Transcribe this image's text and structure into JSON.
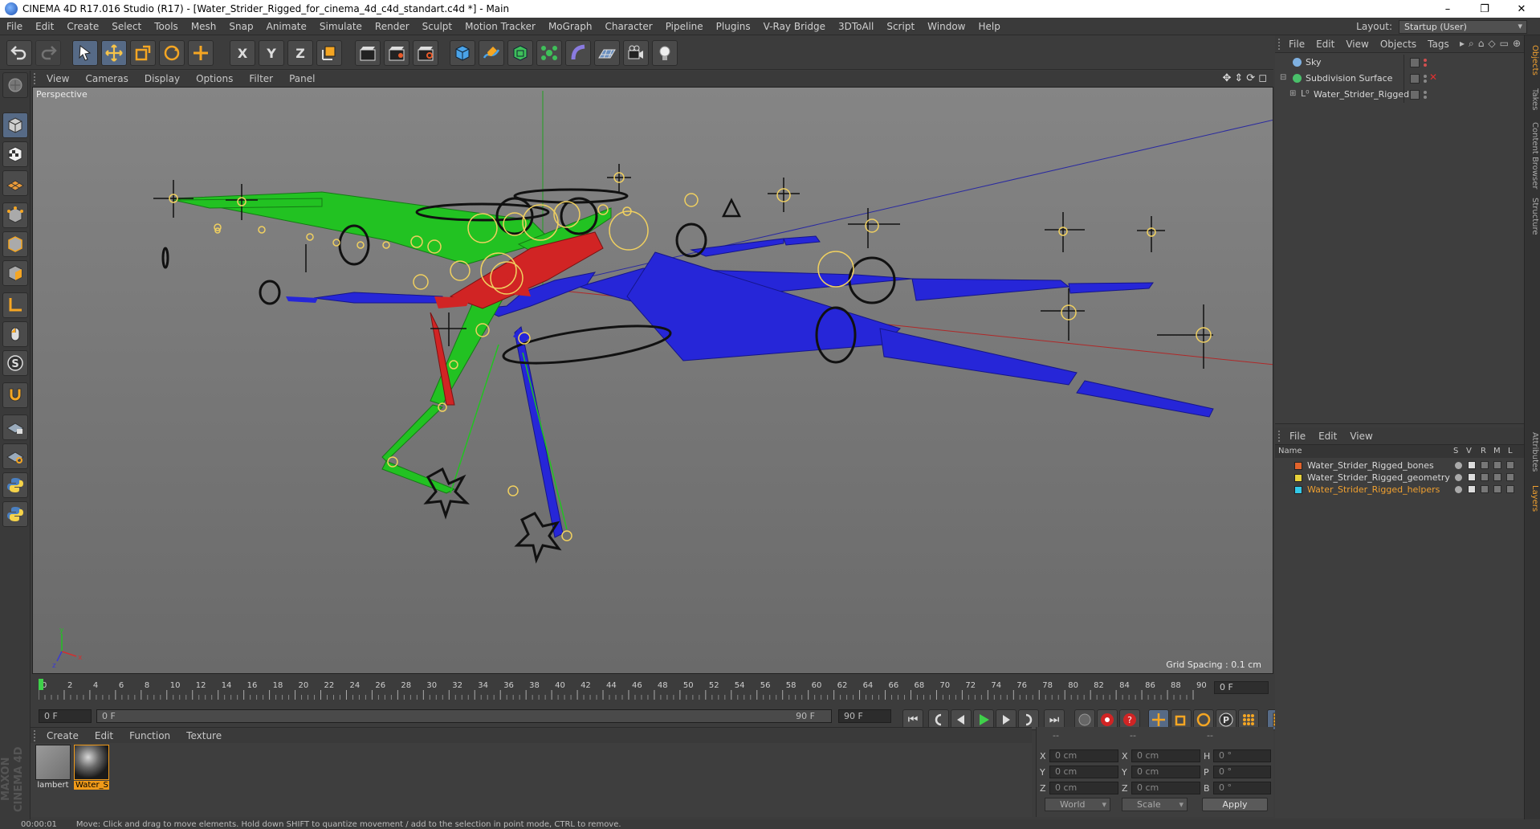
{
  "window": {
    "title": "CINEMA 4D R17.016 Studio (R17) - [Water_Strider_Rigged_for_cinema_4d_c4d_standart.c4d *] - Main",
    "minimize": "–",
    "maximize": "❐",
    "close": "✕"
  },
  "menubar": {
    "items": [
      "File",
      "Edit",
      "Create",
      "Select",
      "Tools",
      "Mesh",
      "Snap",
      "Animate",
      "Simulate",
      "Render",
      "Sculpt",
      "Motion Tracker",
      "MoGraph",
      "Character",
      "Pipeline",
      "Plugins",
      "V-Ray Bridge",
      "3DToAll",
      "Script",
      "Window",
      "Help"
    ],
    "layout_label": "Layout:",
    "layout_value": "Startup (User)"
  },
  "toolbar": {
    "x_label": "X",
    "y_label": "Y",
    "z_label": "Z"
  },
  "viewport": {
    "menu": [
      "View",
      "Cameras",
      "Display",
      "Options",
      "Filter",
      "Panel"
    ],
    "camera_label": "Perspective",
    "grid_spacing": "Grid Spacing : 0.1 cm"
  },
  "timeline": {
    "ticks": [
      "0",
      "2",
      "4",
      "6",
      "8",
      "10",
      "12",
      "14",
      "16",
      "18",
      "20",
      "22",
      "24",
      "26",
      "28",
      "30",
      "32",
      "34",
      "36",
      "38",
      "40",
      "42",
      "44",
      "46",
      "48",
      "50",
      "52",
      "54",
      "56",
      "58",
      "60",
      "62",
      "64",
      "66",
      "68",
      "70",
      "72",
      "74",
      "76",
      "78",
      "80",
      "82",
      "84",
      "86",
      "88",
      "90"
    ],
    "current_frame": "0 F"
  },
  "transport": {
    "start_frame": "0 F",
    "range_start": "0 F",
    "range_end": "90 F",
    "end_frame": "90 F"
  },
  "material_manager": {
    "menu": [
      "Create",
      "Edit",
      "Function",
      "Texture"
    ],
    "materials": [
      {
        "name": "lambert",
        "selected": false
      },
      {
        "name": "Water_S",
        "selected": true
      }
    ]
  },
  "coordinates": {
    "header_pos": "--",
    "header_size": "--",
    "header_rot": "--",
    "rows": [
      {
        "pos_label": "X",
        "pos_value": "0 cm",
        "size_label": "X",
        "size_value": "0 cm",
        "rot_label": "H",
        "rot_value": "0 °"
      },
      {
        "pos_label": "Y",
        "pos_value": "0 cm",
        "size_label": "Y",
        "size_value": "0 cm",
        "rot_label": "P",
        "rot_value": "0 °"
      },
      {
        "pos_label": "Z",
        "pos_value": "0 cm",
        "size_label": "Z",
        "size_value": "0 cm",
        "rot_label": "B",
        "rot_value": "0 °"
      }
    ],
    "coord_system": "World",
    "mode": "Scale",
    "apply_label": "Apply"
  },
  "object_manager": {
    "menu": [
      "File",
      "Edit",
      "View",
      "Objects",
      "Tags"
    ],
    "objects": [
      {
        "name": "Sky",
        "icon_color": "#7fb0e0"
      },
      {
        "name": "Subdivision Surface",
        "icon_color": "#49c06a"
      },
      {
        "name": "Water_Strider_Rigged",
        "icon_color": "#9a9a9a"
      }
    ]
  },
  "layer_manager": {
    "menu": [
      "File",
      "Edit",
      "View"
    ],
    "columns": {
      "name": "Name",
      "s": "S",
      "v": "V",
      "r": "R",
      "m": "M",
      "l": "L"
    },
    "layers": [
      {
        "name": "Water_Strider_Rigged_bones",
        "color": "#e2632b",
        "text_color": "#d8d8d8"
      },
      {
        "name": "Water_Strider_Rigged_geometry",
        "color": "#e8d23a",
        "text_color": "#d8d8d8"
      },
      {
        "name": "Water_Strider_Rigged_helpers",
        "color": "#33c9e8",
        "text_color": "#f0a030"
      }
    ]
  },
  "side_tabs": [
    "Objects",
    "Takes",
    "Content Browser",
    "Structure",
    "Attributes",
    "Layers"
  ],
  "status": {
    "time": "00:00:01",
    "message": "Move: Click and drag to move elements. Hold down SHIFT to quantize movement / add to the selection in point mode, CTRL to remove."
  },
  "logo": {
    "text": "MAXON CINEMA 4D"
  }
}
